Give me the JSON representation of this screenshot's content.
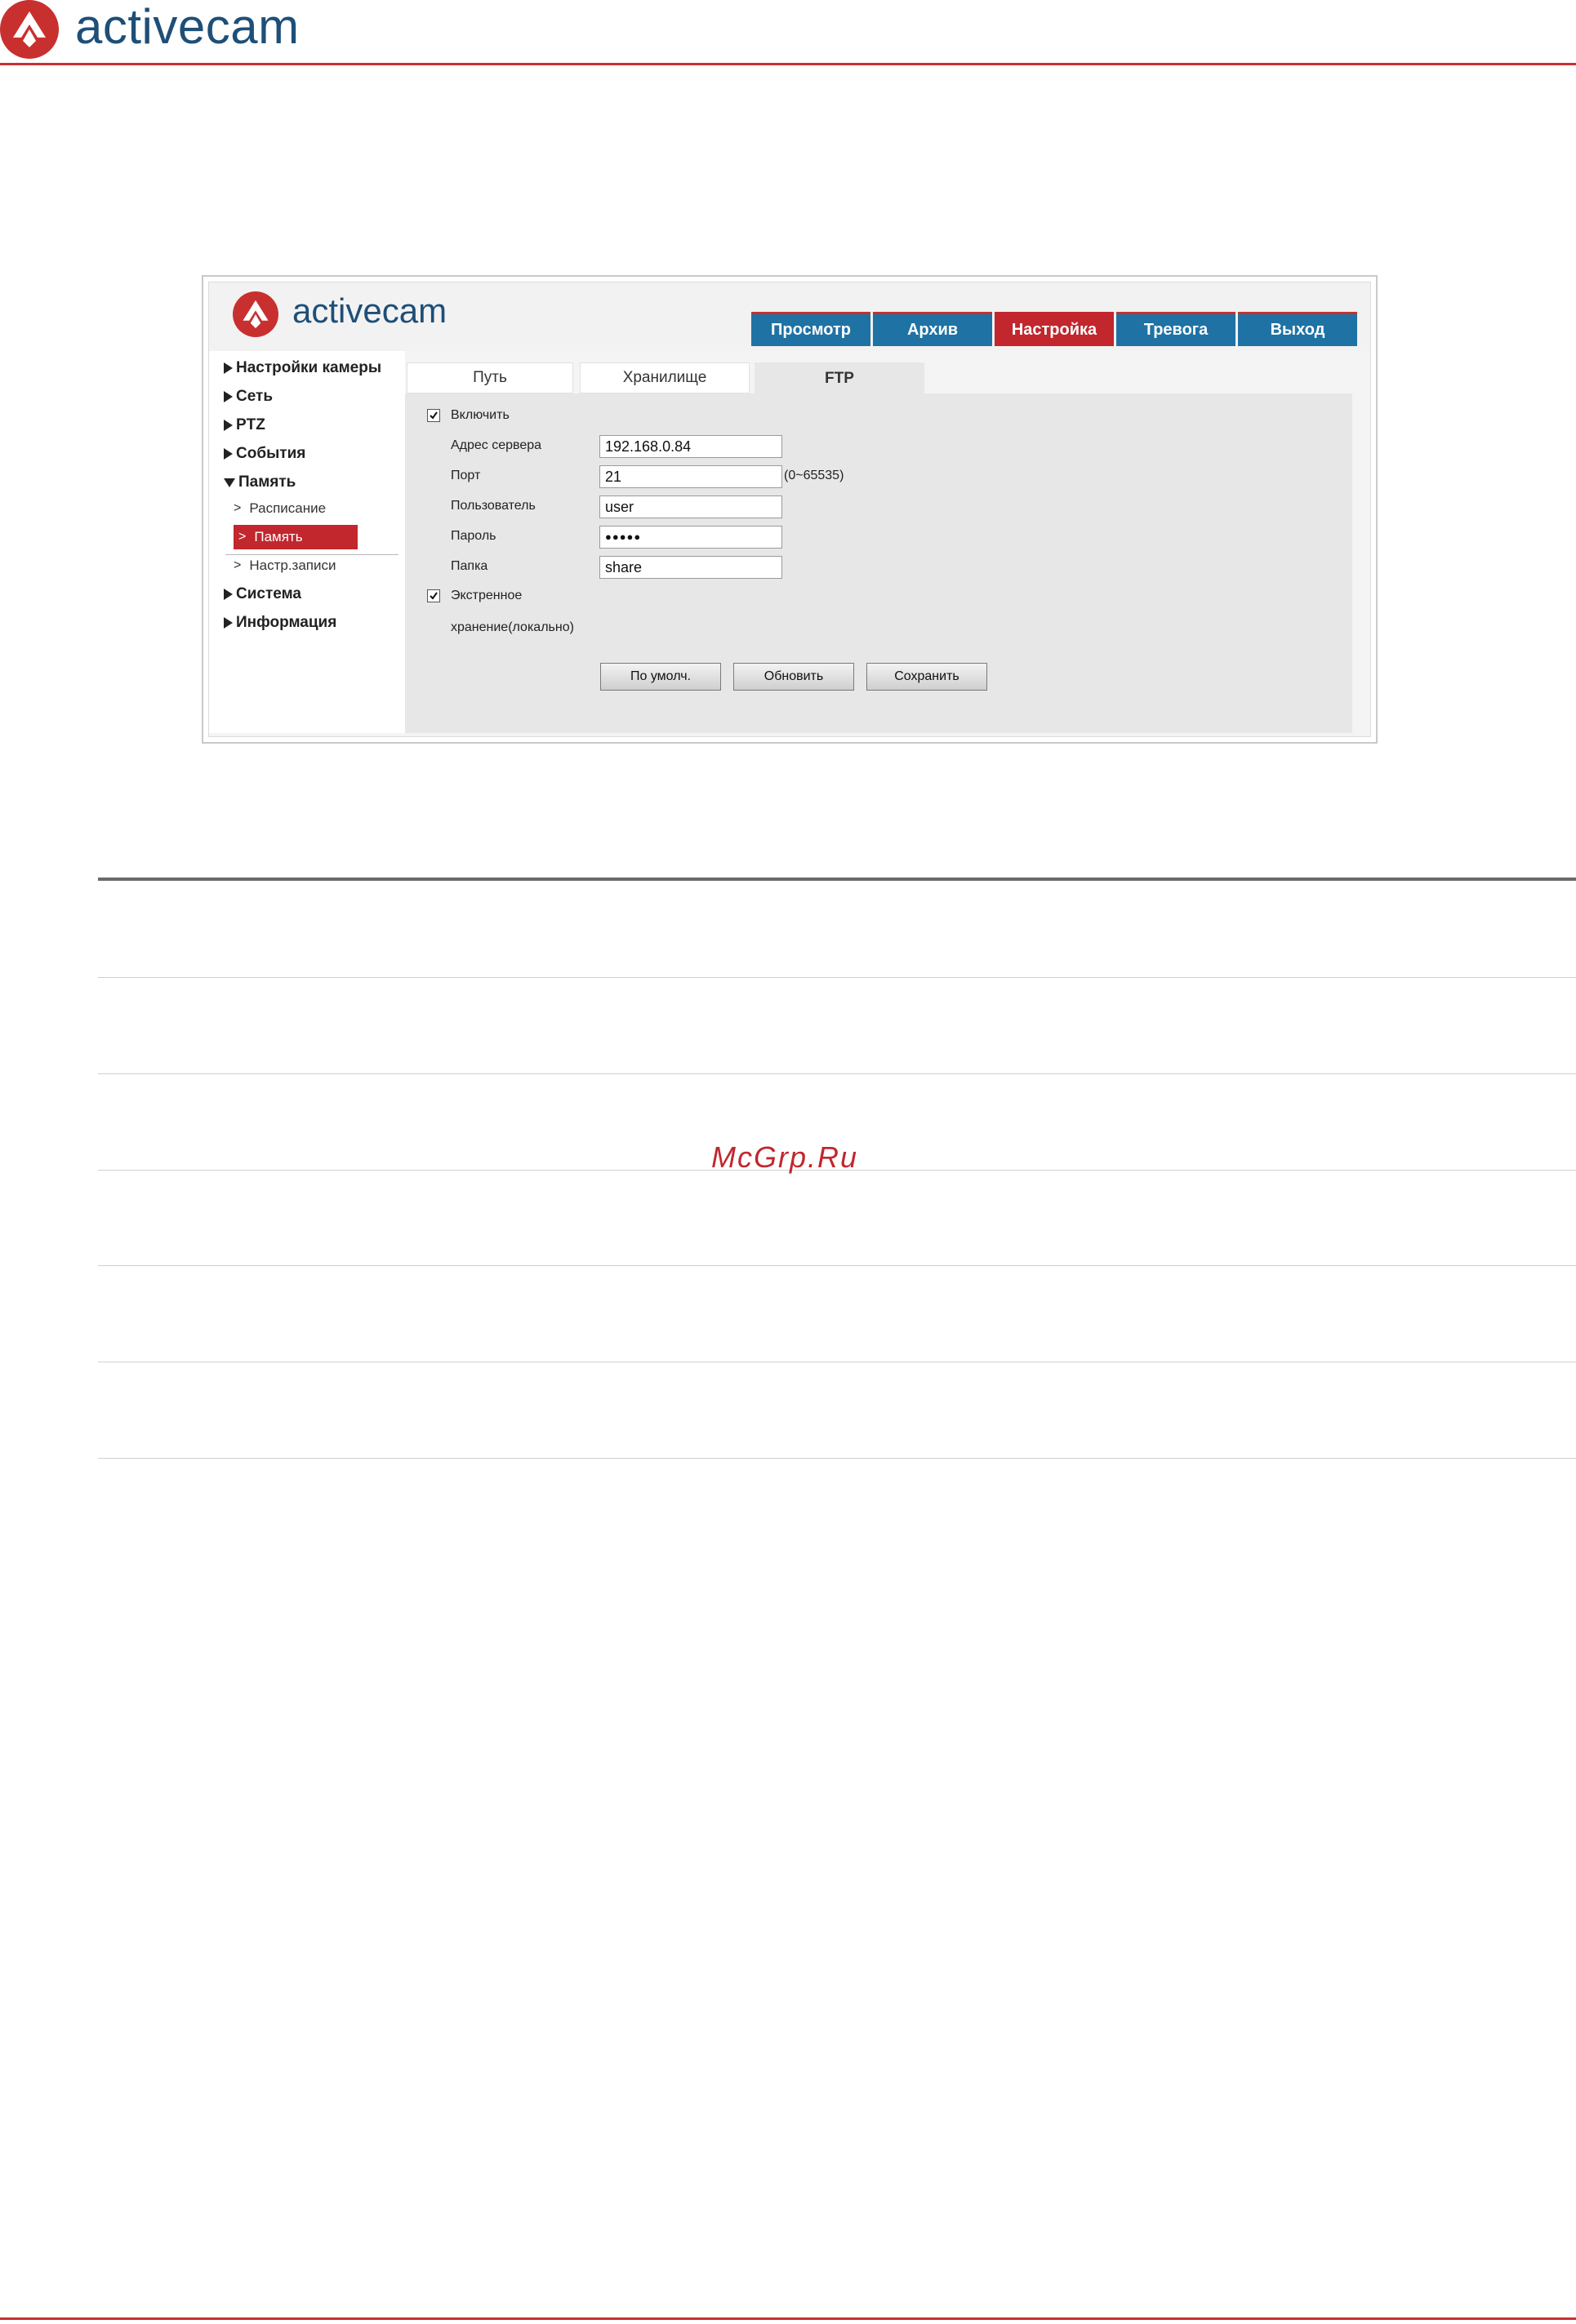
{
  "page": {
    "brand": "activecam",
    "watermark": "McGrp.Ru"
  },
  "app": {
    "brand": "activecam",
    "nav_tabs": [
      {
        "label": "Просмотр",
        "active": false
      },
      {
        "label": "Архив",
        "active": false
      },
      {
        "label": "Настройка",
        "active": true
      },
      {
        "label": "Тревога",
        "active": false
      },
      {
        "label": "Выход",
        "active": false
      }
    ],
    "sidebar": {
      "camera_settings": "Настройки камеры",
      "network": "Сеть",
      "ptz": "PTZ",
      "events": "События",
      "memory": "Память",
      "schedule": "Расписание",
      "memory_sub": "Память",
      "record_settings": "Настр.записи",
      "system": "Система",
      "information": "Информация",
      "chevron": ">"
    },
    "content_tabs": [
      {
        "label": "Путь",
        "active": false
      },
      {
        "label": "Хранилище",
        "active": false
      },
      {
        "label": "FTP",
        "active": true
      }
    ],
    "ftp": {
      "enable_label": "Включить",
      "enable_checked": true,
      "server_label": "Адрес сервера",
      "server_value": "192.168.0.84",
      "port_label": "Порт",
      "port_value": "21",
      "port_hint": "(0~65535)",
      "user_label": "Пользователь",
      "user_value": "user",
      "password_label": "Пароль",
      "password_value": "●●●●●",
      "folder_label": "Папка",
      "folder_value": "share",
      "local_label_line1": "Экстренное",
      "local_label_line2": "хранение(локально)",
      "local_checked": true
    },
    "buttons": {
      "default": "По умолч.",
      "refresh": "Обновить",
      "save": "Сохранить"
    }
  },
  "colors": {
    "brand_red": "#c8302f",
    "brand_blue": "#1d4f78",
    "tab_blue": "#1f72a4",
    "tab_active_red": "#c1272d"
  }
}
